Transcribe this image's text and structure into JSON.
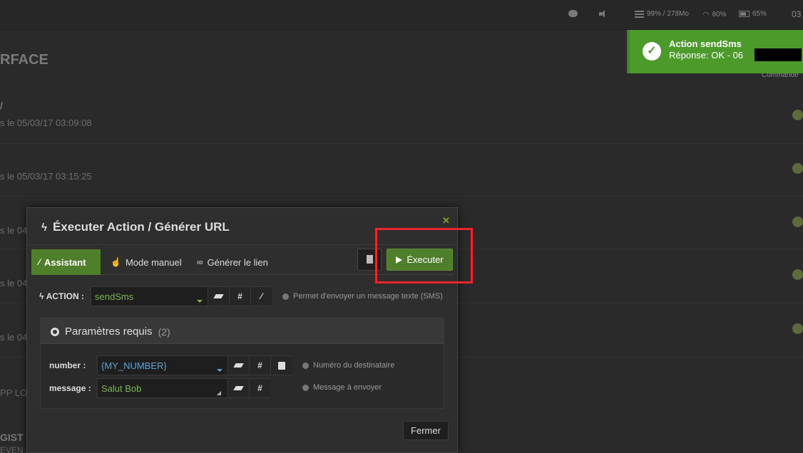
{
  "topbar": {
    "memory": "99% / 278Mo",
    "wifi": "80%",
    "battery": "65%",
    "clock": "03"
  },
  "page": {
    "title": "RFACE",
    "commande_label": "Commande",
    "row_head": "/",
    "rows": [
      {
        "date": "s le 05/03/17 03:09:08"
      },
      {
        "date": "s le 05/03/17 03:15:25"
      },
      {
        "date": "s le 04"
      },
      {
        "date": "s le 04"
      },
      {
        "date": "s le 04"
      }
    ],
    "text_pp": "PP LO",
    "text_gist": "GIST",
    "text_event": "EVEN"
  },
  "toast": {
    "title": "Action sendSms",
    "message": "Réponse: OK - 06"
  },
  "modal": {
    "title": "Éxecuter Action / Générer URL",
    "tabs": [
      {
        "label": "Assistant"
      },
      {
        "label": "Mode manuel"
      },
      {
        "label": "Générer le lien"
      }
    ],
    "execute_label": "Éxecuter",
    "action_label": "ACTION :",
    "action_value": "sendSms",
    "action_hint": "Permet d'envoyer un message texte (SMS)",
    "params_title": "Paramètres requis",
    "params_count": "(2)",
    "params": [
      {
        "label": "number :",
        "value": "{MY_NUMBER}",
        "hint": "Numéro du destinataire"
      },
      {
        "label": "message :",
        "value": "Salut Bob",
        "hint": "Message à envoyer"
      }
    ],
    "close_label": "Fermer"
  },
  "colors": {
    "accent_green": "#4f7f2b",
    "toast_green": "#4c9a2a",
    "highlight_red": "#e8262b",
    "value_blue": "#5aa4d8",
    "value_green": "#7ab64a"
  }
}
